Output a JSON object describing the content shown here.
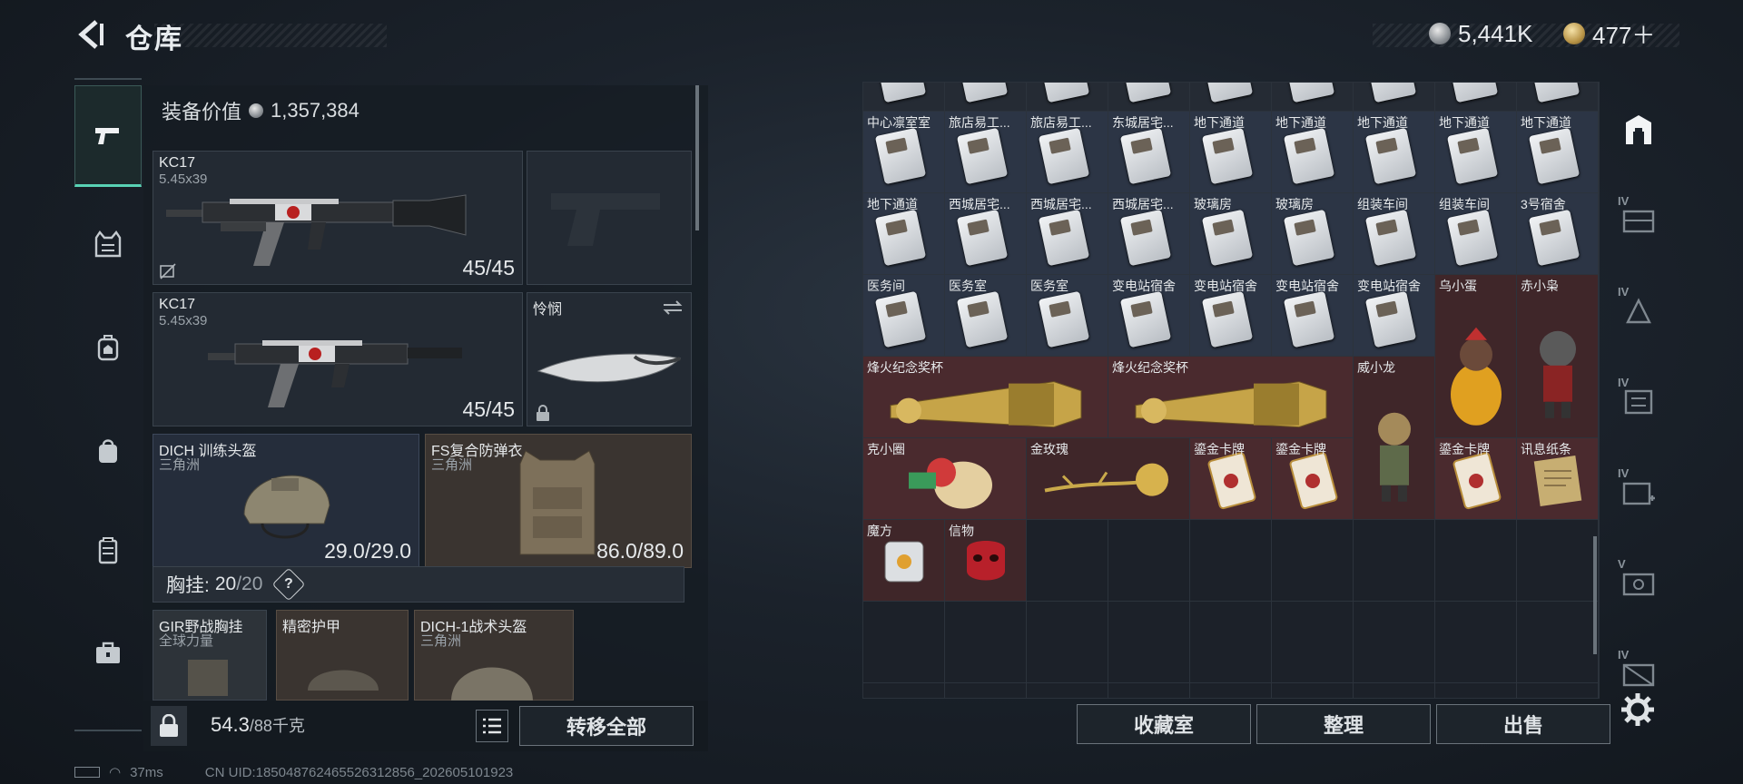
{
  "header": {
    "title": "仓库",
    "currency_silver": "5,441K",
    "currency_gold": "477＋"
  },
  "equip": {
    "value_label": "装备价值",
    "value": "1,357,384",
    "primary": {
      "name": "KC17",
      "caliber": "5.45x39",
      "ammo": "45/45"
    },
    "secondary": {
      "name": "KC17",
      "caliber": "5.45x39",
      "ammo": "45/45"
    },
    "melee": {
      "name": "怜悯"
    },
    "helmet": {
      "name": "DICH 训练头盔",
      "origin": "三角洲",
      "durability": "29.0/29.0"
    },
    "armor": {
      "name": "FS复合防弹衣",
      "origin": "三角洲",
      "durability": "86.0/89.0"
    },
    "chest_label": "胸挂:",
    "chest_value": "20",
    "chest_max": "/20",
    "chest_help": "?",
    "sub_items": [
      {
        "name": "GIR野战胸挂",
        "origin": "全球力量"
      },
      {
        "name": "精密护甲",
        "origin": ""
      },
      {
        "name": "DICH-1战术头盔",
        "origin": "三角洲"
      }
    ]
  },
  "bottom_left": {
    "weight": "54.3",
    "weight_max": "/88千克",
    "transfer_label": "转移全部"
  },
  "grid_items": [
    {
      "name": "中心凛室室"
    },
    {
      "name": "旅店易工..."
    },
    {
      "name": "旅店易工..."
    },
    {
      "name": "东城居宅..."
    },
    {
      "name": "地下通道"
    },
    {
      "name": "地下通道"
    },
    {
      "name": "地下通道"
    },
    {
      "name": "地下通道"
    },
    {
      "name": "地下通道"
    },
    {
      "name": "地下通道"
    },
    {
      "name": "西城居宅..."
    },
    {
      "name": "西城居宅..."
    },
    {
      "name": "西城居宅..."
    },
    {
      "name": "玻璃房"
    },
    {
      "name": "玻璃房"
    },
    {
      "name": "组装车间"
    },
    {
      "name": "组装车间"
    },
    {
      "name": "3号宿舍"
    },
    {
      "name": "医务间"
    },
    {
      "name": "医务室"
    },
    {
      "name": "医务室"
    },
    {
      "name": "变电站宿舍"
    },
    {
      "name": "变电站宿舍"
    },
    {
      "name": "变电站宿舍"
    },
    {
      "name": "变电站宿舍"
    },
    {
      "name": "乌小蛋"
    },
    {
      "name": "赤小枭"
    },
    {
      "name": "烽火纪念奖杯"
    },
    {
      "name": "烽火纪念奖杯"
    },
    {
      "name": "威小龙"
    },
    {
      "name": "克小圈"
    },
    {
      "name": "金玫瑰"
    },
    {
      "name": "鎏金卡牌"
    },
    {
      "name": "鎏金卡牌"
    },
    {
      "name": "鎏金卡牌"
    },
    {
      "name": "讯息纸条"
    },
    {
      "name": "魔方"
    },
    {
      "name": "信物"
    }
  ],
  "bottom_right": {
    "collection": "收藏室",
    "organize": "整理",
    "sell": "出售"
  },
  "right_bar_levels": [
    "IV",
    "IV",
    "IV",
    "IV",
    "V",
    "IV"
  ],
  "status": {
    "ping": "37ms",
    "uid": "CN UID:18504876246552631285​6_202605101923"
  }
}
